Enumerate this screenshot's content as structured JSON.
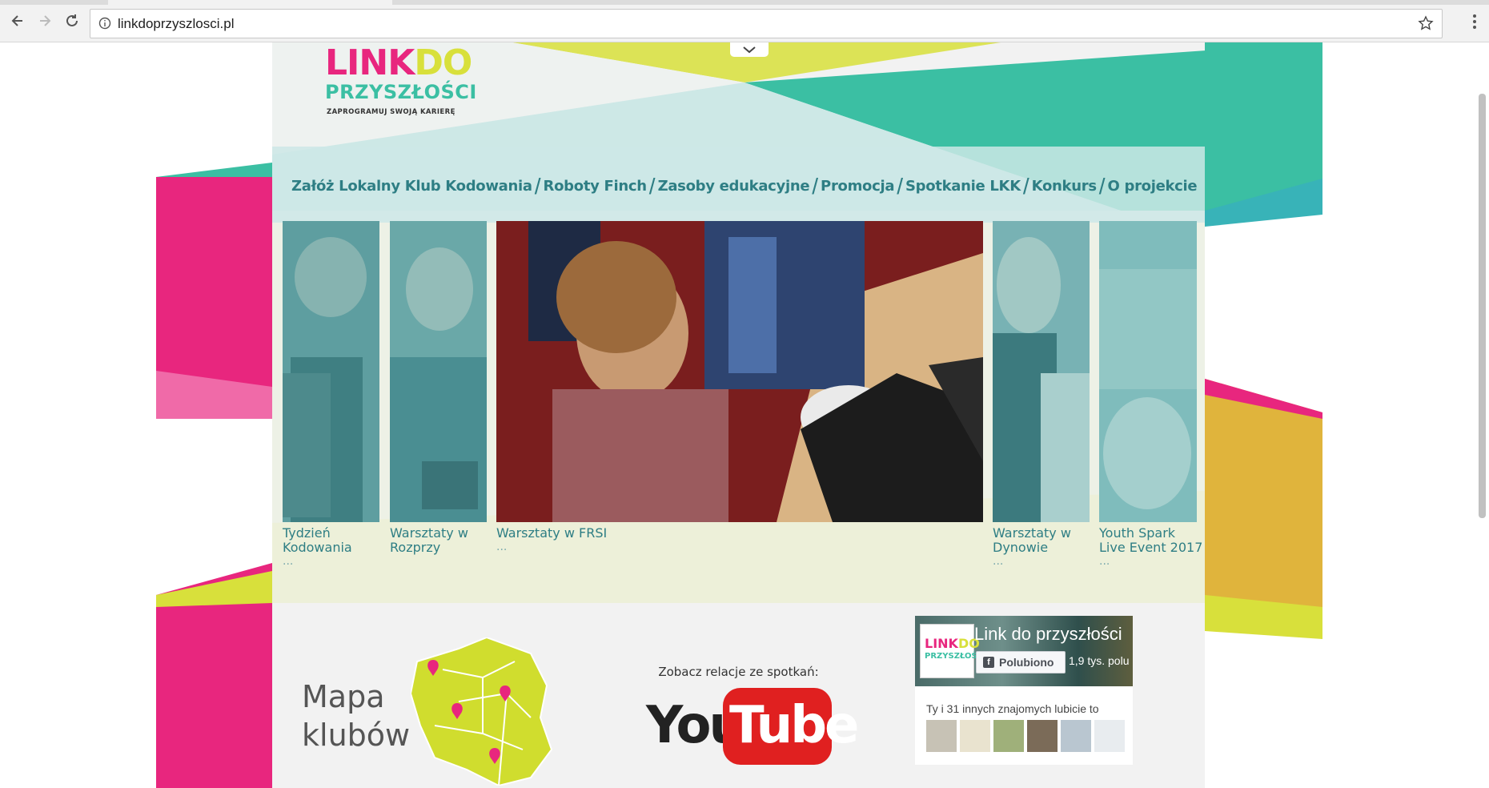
{
  "browser": {
    "url": "linkdoprzyszlosci.pl"
  },
  "logo": {
    "word1": "LINK",
    "word2": "DO",
    "word3": "PRZYSZŁOŚCI",
    "tagline": "ZAPROGRAMUJ SWOJĄ KARIERĘ"
  },
  "nav": {
    "items": [
      {
        "label": "Załóż Lokalny Klub Kodowania"
      },
      {
        "label": "Roboty Finch"
      },
      {
        "label": "Zasoby edukacyjne"
      },
      {
        "label": "Promocja"
      },
      {
        "label": "Spotkanie LKK"
      },
      {
        "label": "Konkurs"
      },
      {
        "label": "O projekcie"
      }
    ],
    "separator": "/"
  },
  "gallery": {
    "slides": [
      {
        "caption_line1": "Tydzień",
        "caption_line2": "Kodowania",
        "more": "..."
      },
      {
        "caption_line1": "Warsztaty w",
        "caption_line2": "Rozprzy",
        "more": ""
      },
      {
        "caption_line1": "Warsztaty w FRSI",
        "caption_line2": "",
        "more": "..."
      },
      {
        "caption_line1": "Warsztaty w",
        "caption_line2": "Dynowie",
        "more": "..."
      },
      {
        "caption_line1": "Youth Spark",
        "caption_line2": "Live Event 2017",
        "more": "..."
      }
    ]
  },
  "boxes": {
    "mapa": {
      "line1": "Mapa",
      "line2": "klubów"
    },
    "youtube": {
      "caption": "Zobacz relacje ze spotkań:",
      "you": "You",
      "tube": "Tube"
    },
    "facebook": {
      "logo_line1a": "LINK",
      "logo_line1b": "DO",
      "logo_line2": "PRZYSZŁOŚCI",
      "page_name": "Link do przyszłości",
      "like_label": "Polubiono",
      "like_count": "1,9 tys. polu",
      "friends_text": "Ty i 31 innych znajomych lubicie to"
    }
  },
  "colors": {
    "magenta": "#e8267e",
    "lime": "#d8e03b",
    "teal": "#3bbfa3",
    "gold": "#e0b43c",
    "nav_text": "#2e7e84"
  }
}
